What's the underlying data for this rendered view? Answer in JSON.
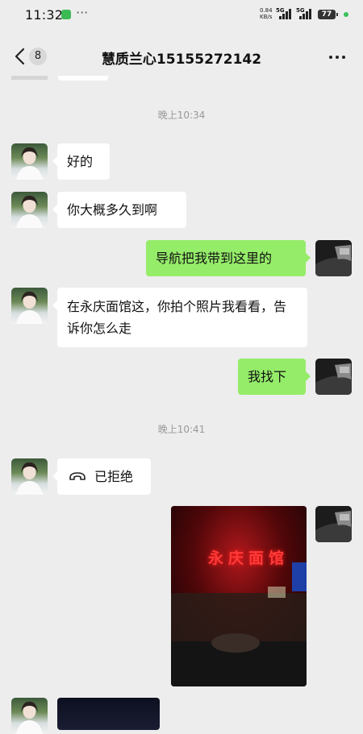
{
  "status_bar": {
    "time": "11:32",
    "net_speed_value": "0.84",
    "net_speed_unit": "KB/s",
    "sim1": "5G",
    "sim2": "5G",
    "battery": "77"
  },
  "header": {
    "unread_count": "8",
    "title": "慧质兰心15155272142"
  },
  "chat": {
    "timestamps": [
      "晚上10:34",
      "晚上10:41"
    ],
    "messages": [
      {
        "side": "left",
        "text": "好的"
      },
      {
        "side": "left",
        "text": "你大概多久到啊"
      },
      {
        "side": "right",
        "text": "导航把我带到这里的"
      },
      {
        "side": "left",
        "text": "在永庆面馆这，你拍个照片我看看，告诉你怎么走"
      },
      {
        "side": "right",
        "text": "我找下"
      },
      {
        "side": "left",
        "call_status": "已拒绝",
        "icon": "phone-declined-icon"
      },
      {
        "side": "right",
        "type": "image",
        "caption_text": "永庆面馆"
      },
      {
        "side": "left",
        "type": "image"
      }
    ],
    "bubble_colors": {
      "sent": "#95ec69",
      "received": "#ffffff"
    }
  }
}
